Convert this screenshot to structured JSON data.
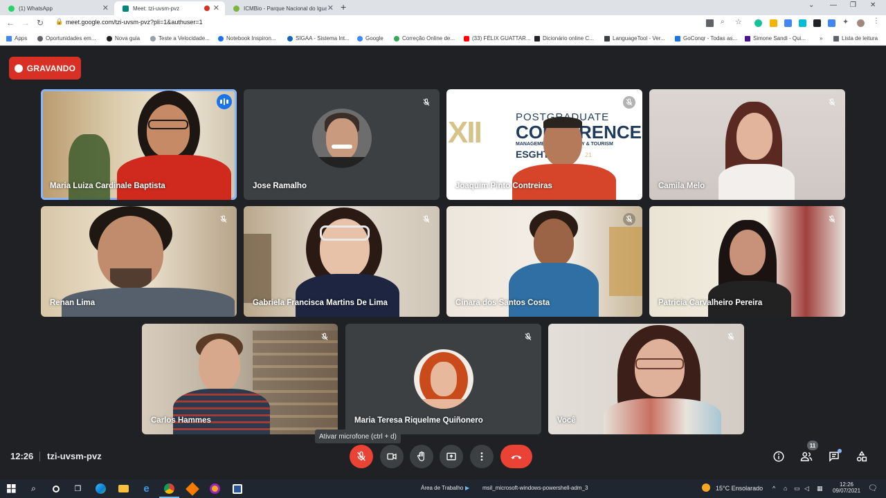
{
  "browser": {
    "tabs": [
      {
        "title": "(1) WhatsApp",
        "color": "#25d366"
      },
      {
        "title": "Meet: tzi-uvsm-pvz",
        "color": "#00897b"
      },
      {
        "title": "ICMBio - Parque Nacional do Iguaçu",
        "color": "#7cb342"
      }
    ],
    "url": "meet.google.com/tzi-uvsm-pvz?pli=1&authuser=1",
    "bookmarks": [
      {
        "label": "Apps"
      },
      {
        "label": "Oportunidades em..."
      },
      {
        "label": "Nova guia"
      },
      {
        "label": "Teste a Velocidade..."
      },
      {
        "label": "Notebook Inspiron..."
      },
      {
        "label": "SIGAA - Sistema Int..."
      },
      {
        "label": "Google"
      },
      {
        "label": "Correção Online de..."
      },
      {
        "label": "(33) FÉLIX GUATTAR..."
      },
      {
        "label": "Dicionário online C..."
      },
      {
        "label": "LanguageTool - Ver..."
      },
      {
        "label": "GoConqr - Todas as..."
      },
      {
        "label": "Simone Sandi - Qui..."
      },
      {
        "label": "Lista de leitura"
      }
    ]
  },
  "meet": {
    "recording_label": "GRAVANDO",
    "participants": [
      {
        "name": "Maria Luiza Cardinale Baptista",
        "speaking": true
      },
      {
        "name": "Jose Ramalho",
        "muted": true
      },
      {
        "name": "Joaquim Pinto Contreiras",
        "muted": true
      },
      {
        "name": "Camila Melo",
        "muted": true
      },
      {
        "name": "Renan Lima",
        "muted": true
      },
      {
        "name": "Gabriela Francisca Martins De Lima",
        "muted": true
      },
      {
        "name": "Cinara dos Santos Costa",
        "muted": true
      },
      {
        "name": "Patricia Carvalheiro Pereira",
        "muted": true
      },
      {
        "name": "Carlos Hammes",
        "muted": true
      },
      {
        "name": "Maria Teresa Riquelme Quiñonero",
        "muted": true
      },
      {
        "name": "Você",
        "muted": true
      }
    ],
    "conference_banner": {
      "line1": "POSTGRADUATE",
      "line2": "CONFERENCE",
      "roman": "XII",
      "line3": "MANAGEMENT, HOSPITALITY & TOURISM",
      "line4": "ESGHT",
      "suffix": "21"
    },
    "tooltip": "Ativar microfone (ctrl + d)",
    "time": "12:26",
    "meeting_code": "tzi-uvsm-pvz",
    "participant_count": "11"
  },
  "taskbar": {
    "desktop_label": "Área de Trabalho",
    "window_label": "msil_microsoft-windows-powershell-adm_3",
    "weather": "15°C  Ensolarado",
    "time": "12:26",
    "date": "09/07/2021"
  }
}
